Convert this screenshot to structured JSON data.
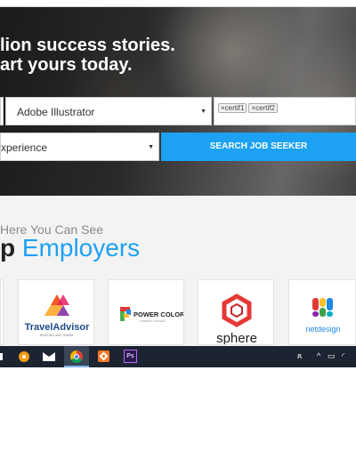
{
  "hero": {
    "headline_line1": "lion success stories.",
    "headline_line2": "art yours today.",
    "skill_select": "Adobe Illustrator",
    "cert_tags": [
      "certif1",
      "certif2"
    ],
    "experience_select": "xperience",
    "search_button": "SEARCH JOB SEEKER"
  },
  "employers": {
    "subtitle": "Here You Can See",
    "title_bold": "p",
    "title_accent": "Employers",
    "logos": [
      {
        "name": "TravelAdvisor",
        "tagline": "BOOKING AND TRAVEL"
      },
      {
        "name": "POWER COLOR",
        "tagline": "COMPANY SLOGAN"
      },
      {
        "name": "sphere",
        "tagline": ""
      },
      {
        "name": "netdesign",
        "tagline": ""
      }
    ]
  },
  "taskbar": {
    "ps_label": "Ps",
    "accent": "#1da1f2"
  }
}
